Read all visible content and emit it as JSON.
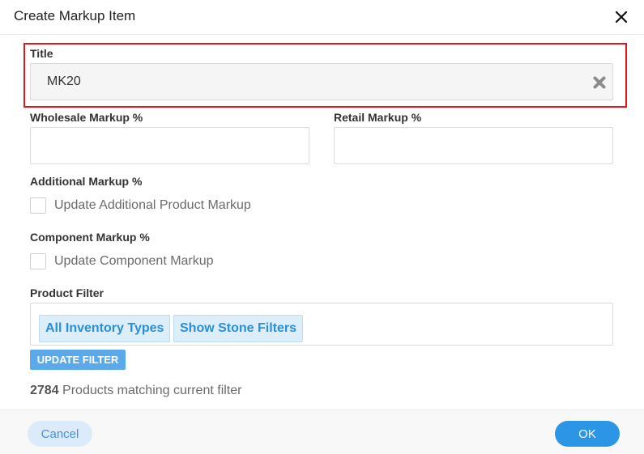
{
  "dialog": {
    "title": "Create Markup Item"
  },
  "form": {
    "title_label": "Title",
    "title_value": "MK20",
    "wholesale_label": "Wholesale Markup %",
    "wholesale_value": "",
    "retail_label": "Retail Markup %",
    "retail_value": "",
    "additional_label": "Additional Markup %",
    "additional_checkbox_label": "Update Additional Product Markup",
    "additional_checked": false,
    "component_label": "Component Markup %",
    "component_checkbox_label": "Update Component Markup",
    "component_checked": false,
    "product_filter_label": "Product Filter",
    "filter_chips": [
      "All Inventory Types",
      "Show Stone Filters"
    ],
    "update_filter_label": "UPDATE FILTER",
    "match_count": "2784",
    "match_text": "Products matching current filter"
  },
  "footer": {
    "cancel_label": "Cancel",
    "ok_label": "OK"
  },
  "icons": {
    "close": "close-icon",
    "clear": "clear-icon"
  },
  "colors": {
    "highlight": "#e0161e",
    "primary": "#2d95e6",
    "chip_text": "#2a8fd8"
  }
}
